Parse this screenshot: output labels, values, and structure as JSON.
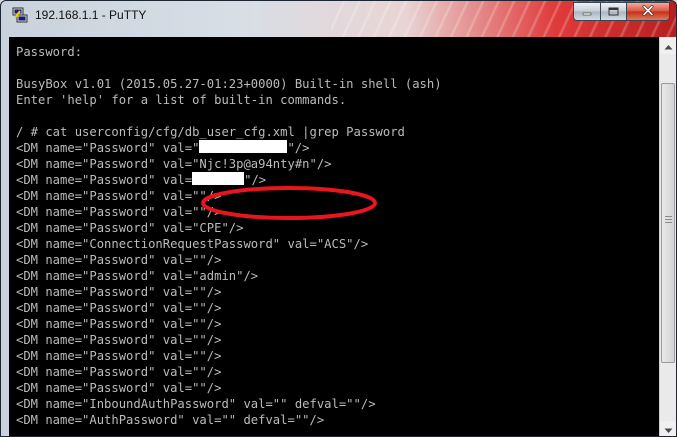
{
  "window": {
    "title": "192.168.1.1 - PuTTY"
  },
  "icons": {
    "app": "putty-icon",
    "minimize": "minimize-icon",
    "maximize": "maximize-icon",
    "close": "close-icon",
    "scroll_up": "scroll-up-arrow-icon",
    "scroll_down": "scroll-down-arrow-icon"
  },
  "colors": {
    "terminal_background": "#000000",
    "terminal_text": "#bbbbbb",
    "highlight_ellipse": "#e8141e",
    "redaction": "#ffffff"
  },
  "terminal": {
    "lines": [
      "Password:",
      "",
      "BusyBox v1.01 (2015.05.27-01:23+0000) Built-in shell (ash)",
      "Enter 'help' for a list of built-in commands.",
      "",
      "/ # cat userconfig/cfg/db_user_cfg.xml |grep Password",
      "<DM name=\"Password\" val=\"",
      "<DM name=\"Password\" val=\"Njc!3p@a94nty#n\"/>",
      "<DM name=\"Password\" val=",
      "<DM name=\"Password\" val=\"\"/>",
      "<DM name=\"Password\" val=\"\"/>",
      "<DM name=\"Password\" val=\"CPE\"/>",
      "<DM name=\"ConnectionRequestPassword\" val=\"ACS\"/>",
      "<DM name=\"Password\" val=\"\"/>",
      "<DM name=\"Password\" val=\"admin\"/>",
      "<DM name=\"Password\" val=\"\"/>",
      "<DM name=\"Password\" val=\"\"/>",
      "<DM name=\"Password\" val=\"\"/>",
      "<DM name=\"Password\" val=\"\"/>",
      "<DM name=\"Password\" val=\"\"/>",
      "<DM name=\"Password\" val=\"\"/>",
      "<DM name=\"Password\" val=\"\"/>",
      "<DM name=\"InboundAuthPassword\" val=\"\" defval=\"\"/>",
      "<DM name=\"AuthPassword\" val=\"\" defval=\"\"/>"
    ],
    "redacted_tails": {
      "line_6": "\"/>",
      "line_8": "\"/>"
    }
  },
  "scrollbar": {
    "position_fraction": 0.12,
    "visible_fraction": 0.73
  }
}
